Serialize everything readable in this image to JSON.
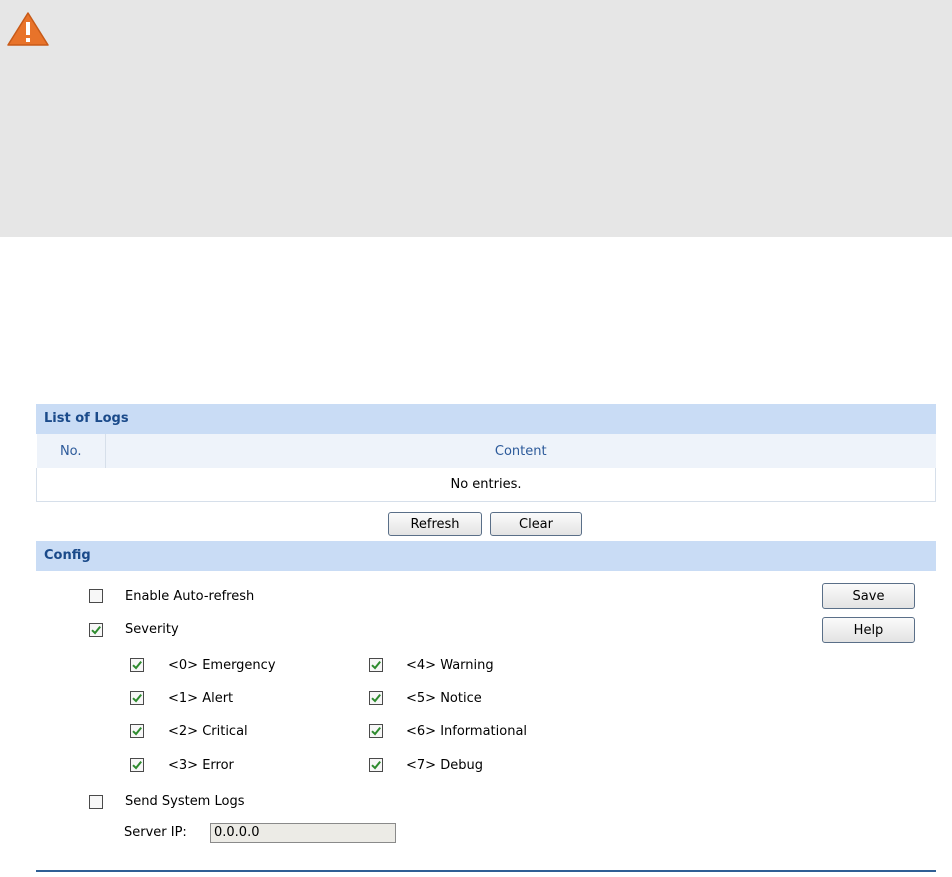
{
  "notice": {
    "icon": "warning-icon"
  },
  "logs": {
    "title": "List of Logs",
    "columns": [
      "No.",
      "Content"
    ],
    "empty_text": "No entries.",
    "refresh_label": "Refresh",
    "clear_label": "Clear"
  },
  "config": {
    "title": "Config",
    "auto_refresh": {
      "label": "Enable Auto-refresh",
      "checked": false
    },
    "severity": {
      "label": "Severity",
      "checked": true
    },
    "levels": [
      {
        "label": "<0> Emergency",
        "checked": true
      },
      {
        "label": "<1> Alert",
        "checked": true
      },
      {
        "label": "<2> Critical",
        "checked": true
      },
      {
        "label": "<3> Error",
        "checked": true
      },
      {
        "label": "<4> Warning",
        "checked": true
      },
      {
        "label": "<5> Notice",
        "checked": true
      },
      {
        "label": "<6> Informational",
        "checked": true
      },
      {
        "label": "<7> Debug",
        "checked": true
      }
    ],
    "send_logs": {
      "label": "Send System Logs",
      "checked": false
    },
    "server_ip_label": "Server IP:",
    "server_ip_value": "0.0.0.0",
    "save_label": "Save",
    "help_label": "Help"
  },
  "colors": {
    "header_bg": "#c9dcf5",
    "accent": "#1a4a8a",
    "check": "#2e8b2e",
    "warning": "#e8732a"
  }
}
